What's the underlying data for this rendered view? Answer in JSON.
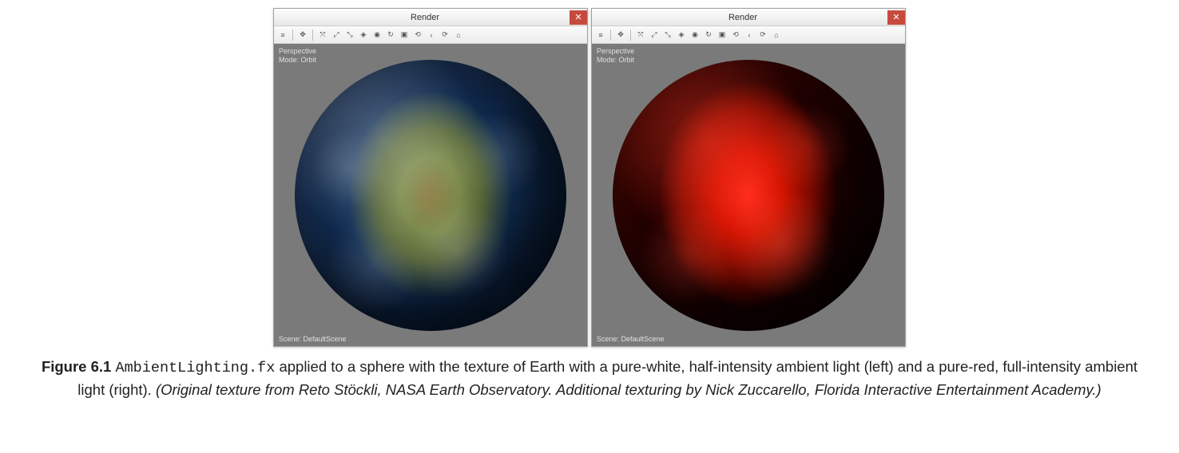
{
  "windows": {
    "left": {
      "title": "Render",
      "close": "✕",
      "view_label_line1": "Perspective",
      "view_label_line2": "Mode: Orbit",
      "scene_label": "Scene: DefaultScene"
    },
    "right": {
      "title": "Render",
      "close": "✕",
      "view_label_line1": "Perspective",
      "view_label_line2": "Mode: Orbit",
      "scene_label": "Scene: DefaultScene"
    }
  },
  "toolbar_icons": {
    "i0": "≡",
    "i1": "✥",
    "i2": "⤧",
    "i3": "⤢",
    "i4": "⤡",
    "i5": "◈",
    "i6": "◉",
    "i7": "↻",
    "i8": "▣",
    "i9": "⟲",
    "i10": "‹",
    "i11": "⟳",
    "i12": "⌂"
  },
  "caption": {
    "figure_label": "Figure 6.1",
    "code_name": "AmbientLighting.fx",
    "body_pre": " applied to a sphere with the texture of Earth with a pure-white, half-intensity ambient light (left) and a pure-red, full-intensity ambient light (right). ",
    "attribution": "(Original texture from Reto Stöckli, NASA Earth Observatory. Additional texturing by Nick Zuccarello, Florida Interactive Entertainment Academy.)"
  }
}
